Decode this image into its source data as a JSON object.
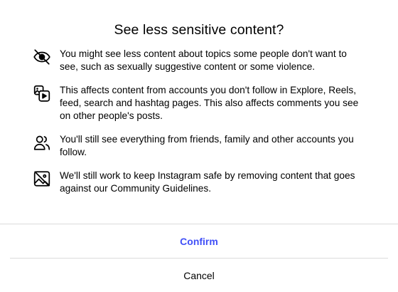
{
  "dialog": {
    "title": "See less sensitive content?",
    "items": [
      {
        "icon": "eye-off-icon",
        "text": "You might see less content about topics some people don't want to see, such as sexually suggestive content or some violence."
      },
      {
        "icon": "media-stack-icon",
        "text": "This affects content from accounts you don't follow in Explore, Reels, feed, search and hashtag pages. This also affects comments you see on other people's posts."
      },
      {
        "icon": "people-icon",
        "text": "You'll still see everything from friends, family and other accounts you follow."
      },
      {
        "icon": "image-off-icon",
        "text": "We'll still work to keep Instagram safe by removing content that goes against our Community Guidelines."
      }
    ],
    "confirm_label": "Confirm",
    "cancel_label": "Cancel"
  },
  "colors": {
    "confirm": "#4150f7",
    "divider": "#dbdbdb",
    "text": "#000000",
    "background": "#ffffff"
  }
}
